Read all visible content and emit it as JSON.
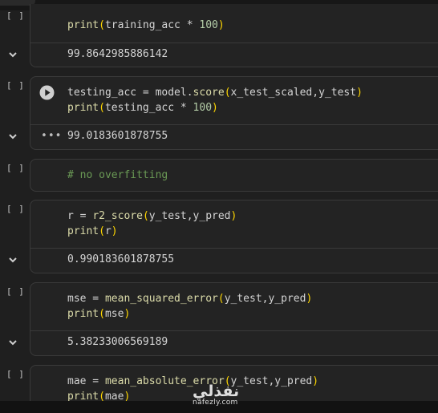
{
  "cells": [
    {
      "code_lines": [
        "print(training_acc * 100)"
      ],
      "output": "99.8642985886142"
    },
    {
      "bracket": "[ ]",
      "code_lines": [
        "testing_acc = model.score(x_test_scaled,y_test)",
        "print(testing_acc * 100)"
      ],
      "output": "99.0183601878755",
      "output_menu": "•••"
    },
    {
      "bracket": "[ ]",
      "code_lines": [
        "# no overfitting"
      ]
    },
    {
      "bracket": "[ ]",
      "code_lines": [
        "r = r2_score(y_test,y_pred)",
        "print(r)"
      ],
      "output": "0.990183601878755"
    },
    {
      "bracket": "[ ]",
      "code_lines": [
        "mse = mean_squared_error(y_test,y_pred)",
        "print(mse)"
      ],
      "output": "5.38233006569189"
    },
    {
      "bracket": "[ ]",
      "code_lines": [
        "mae = mean_absolute_error(y_test,y_pred)",
        "print(mae)"
      ]
    }
  ],
  "bracket_top": "[ ]",
  "watermark": {
    "logo": "نفذلي",
    "url": "nafezly.com"
  },
  "icons": {
    "run": "play-circle-icon",
    "collapse": "chevron-down-icon",
    "menu": "more-horizontal-icon"
  },
  "colors": {
    "background": "#1e1e1e",
    "function": "#dcdcaa",
    "paren": "#ffd700",
    "number": "#b5cea8",
    "comment": "#6a9955"
  }
}
